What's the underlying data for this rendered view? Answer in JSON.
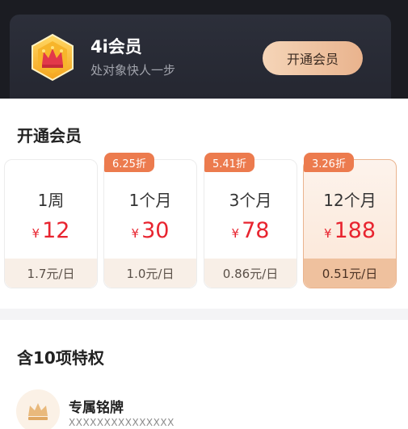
{
  "header": {
    "title": "4i会员",
    "subtitle": "处对象快人一步",
    "cta_label": "开通会员",
    "badge_icon": "crown-hexagon-icon"
  },
  "plans_section": {
    "title": "开通会员",
    "currency": "¥",
    "plans": [
      {
        "period": "1周",
        "price": "12",
        "per_day": "1.7元/日",
        "discount": ""
      },
      {
        "period": "1个月",
        "price": "30",
        "per_day": "1.0元/日",
        "discount": "6.25折"
      },
      {
        "period": "3个月",
        "price": "78",
        "per_day": "0.86元/日",
        "discount": "5.41折"
      },
      {
        "period": "12个月",
        "price": "188",
        "per_day": "0.51元/日",
        "discount": "3.26折"
      }
    ],
    "selected_index": 3
  },
  "privileges": {
    "title": "含10项特权",
    "items": [
      {
        "name": "专属铭牌",
        "desc": "XXXXXXXXXXXXXXX",
        "icon": "crown-icon"
      }
    ]
  },
  "colors": {
    "dark_bg": "#1b1c22",
    "price_red": "#e8242f",
    "discount_orange": "#ec7b4e",
    "gold_button": "#e9b38d"
  }
}
